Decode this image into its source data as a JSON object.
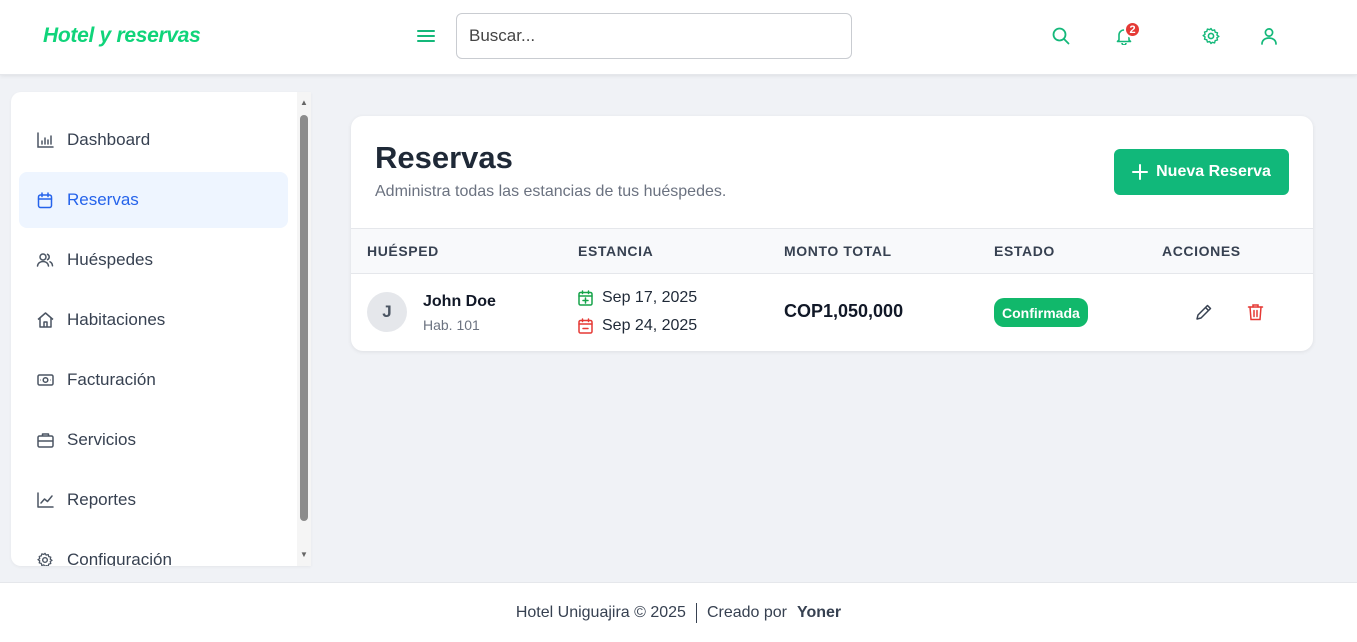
{
  "app": {
    "brand": "Hotel y reservas",
    "brand_color": "#10d47a"
  },
  "header": {
    "search_placeholder": "Buscar...",
    "notifications_count": "2",
    "icons": [
      "menu-icon",
      "search-icon",
      "bell-icon",
      "gear-icon",
      "user-icon"
    ]
  },
  "sidebar": {
    "items": [
      {
        "label": "Dashboard",
        "icon": "bar-chart-icon",
        "active": false
      },
      {
        "label": "Reservas",
        "icon": "calendar-icon",
        "active": true
      },
      {
        "label": "Huéspedes",
        "icon": "users-icon",
        "active": false
      },
      {
        "label": "Habitaciones",
        "icon": "home-icon",
        "active": false
      },
      {
        "label": "Facturación",
        "icon": "money-icon",
        "active": false
      },
      {
        "label": "Servicios",
        "icon": "briefcase-icon",
        "active": false
      },
      {
        "label": "Reportes",
        "icon": "trend-chart-icon",
        "active": false
      },
      {
        "label": "Configuración",
        "icon": "gear-icon",
        "active": false
      }
    ]
  },
  "main": {
    "title": "Reservas",
    "subtitle": "Administra todas las estancias de tus huéspedes.",
    "new_button": "Nueva Reserva",
    "columns": [
      "HUÉSPED",
      "ESTANCIA",
      "MONTO TOTAL",
      "ESTADO",
      "ACCIONES"
    ],
    "rows": [
      {
        "initial": "J",
        "guest": "John Doe",
        "room": "Hab. 101",
        "checkin": "Sep 17, 2025",
        "checkout": "Sep 24, 2025",
        "amount": "COP1,050,000",
        "status": "Confirmada"
      }
    ],
    "accent": "#11b87a",
    "danger": "#e53935"
  },
  "footer": {
    "left": "Hotel Uniguajira © 2025",
    "created_by": "Creado por",
    "author": "Yoner"
  }
}
